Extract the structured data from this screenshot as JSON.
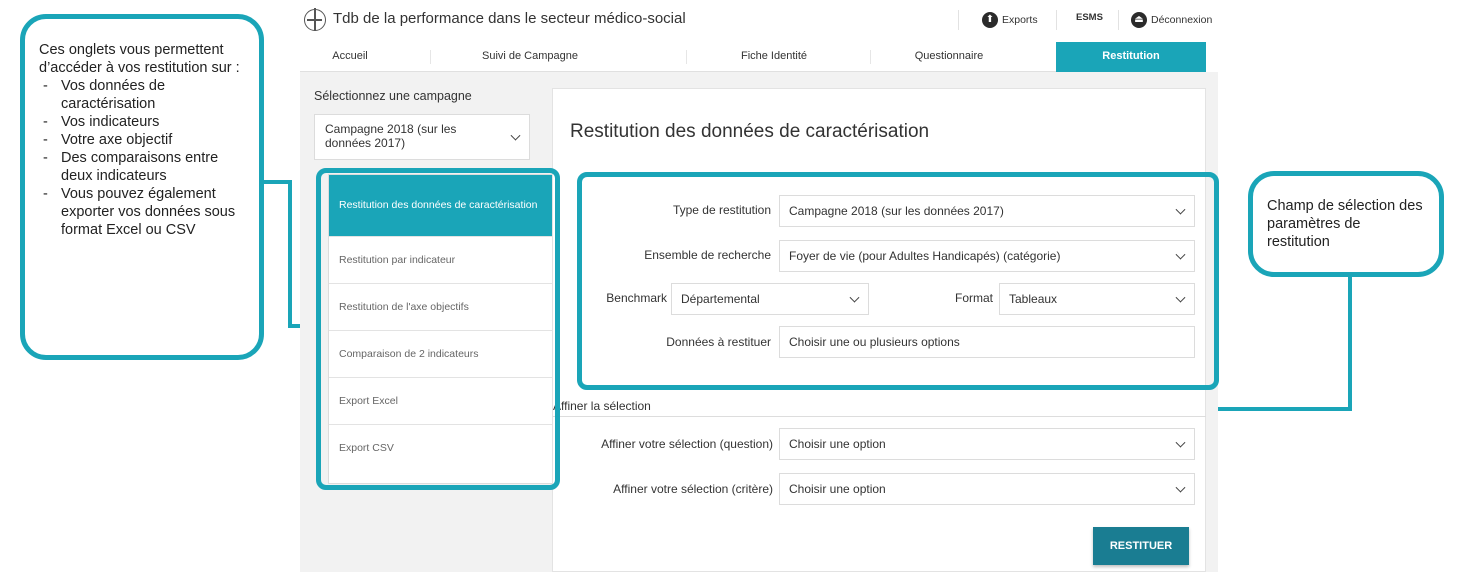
{
  "annotations": {
    "left": {
      "intro": "Ces onglets vous permettent d’accéder à vos restitution sur :",
      "bullets": [
        "Vos données de caractérisation",
        "Vos indicateurs",
        "Votre axe objectif",
        "Des comparaisons entre deux indicateurs",
        "Vous pouvez également exporter vos données sous format Excel ou CSV"
      ]
    },
    "right": {
      "text": "Champ de sélection des paramètres de restitution"
    },
    "color": "#1aa5b8"
  },
  "header": {
    "title": "Tdb de la performance dans le secteur médico-social",
    "exports_label": "Exports",
    "esms_label": "ESMS",
    "logout_label": "Déconnexion"
  },
  "tabs": [
    {
      "label": "Accueil",
      "active": false
    },
    {
      "label": "Suivi de Campagne",
      "active": false
    },
    {
      "label": "Fiche Identité",
      "active": false
    },
    {
      "label": "Questionnaire",
      "active": false
    },
    {
      "label": "Restitution",
      "active": true
    }
  ],
  "sidebar": {
    "campaign_label": "Sélectionnez une campagne",
    "campaign_value": "Campagne 2018 (sur les données 2017)",
    "items": [
      {
        "label": "Restitution des données de caractérisation",
        "active": true
      },
      {
        "label": "Restitution par indicateur",
        "active": false
      },
      {
        "label": "Restitution de l'axe objectifs",
        "active": false
      },
      {
        "label": "Comparaison de 2 indicateurs",
        "active": false
      },
      {
        "label": "Export Excel",
        "active": false
      },
      {
        "label": "Export CSV",
        "active": false
      }
    ]
  },
  "main": {
    "title": "Restitution des données de caractérisation",
    "fields": {
      "type": {
        "label": "Type de restitution",
        "value": "Campagne 2018 (sur les données 2017)"
      },
      "ensemble": {
        "label": "Ensemble de recherche",
        "value": "Foyer de vie (pour Adultes Handicapés) (catégorie)"
      },
      "benchmark": {
        "label": "Benchmark",
        "value": "Départemental"
      },
      "format": {
        "label": "Format",
        "value": "Tableaux"
      },
      "donnees": {
        "label": "Données à restituer",
        "placeholder": "Choisir une ou plusieurs options"
      }
    },
    "refine": {
      "title": "Affiner la sélection",
      "question": {
        "label": "Affiner votre sélection (question)",
        "placeholder": "Choisir une option"
      },
      "critere": {
        "label": "Affiner votre sélection (critère)",
        "placeholder": "Choisir une option"
      }
    },
    "submit_label": "RESTITUER"
  },
  "colors": {
    "accent": "#1aa5b8",
    "button": "#1a7d92",
    "background": "#f2f2f2"
  }
}
